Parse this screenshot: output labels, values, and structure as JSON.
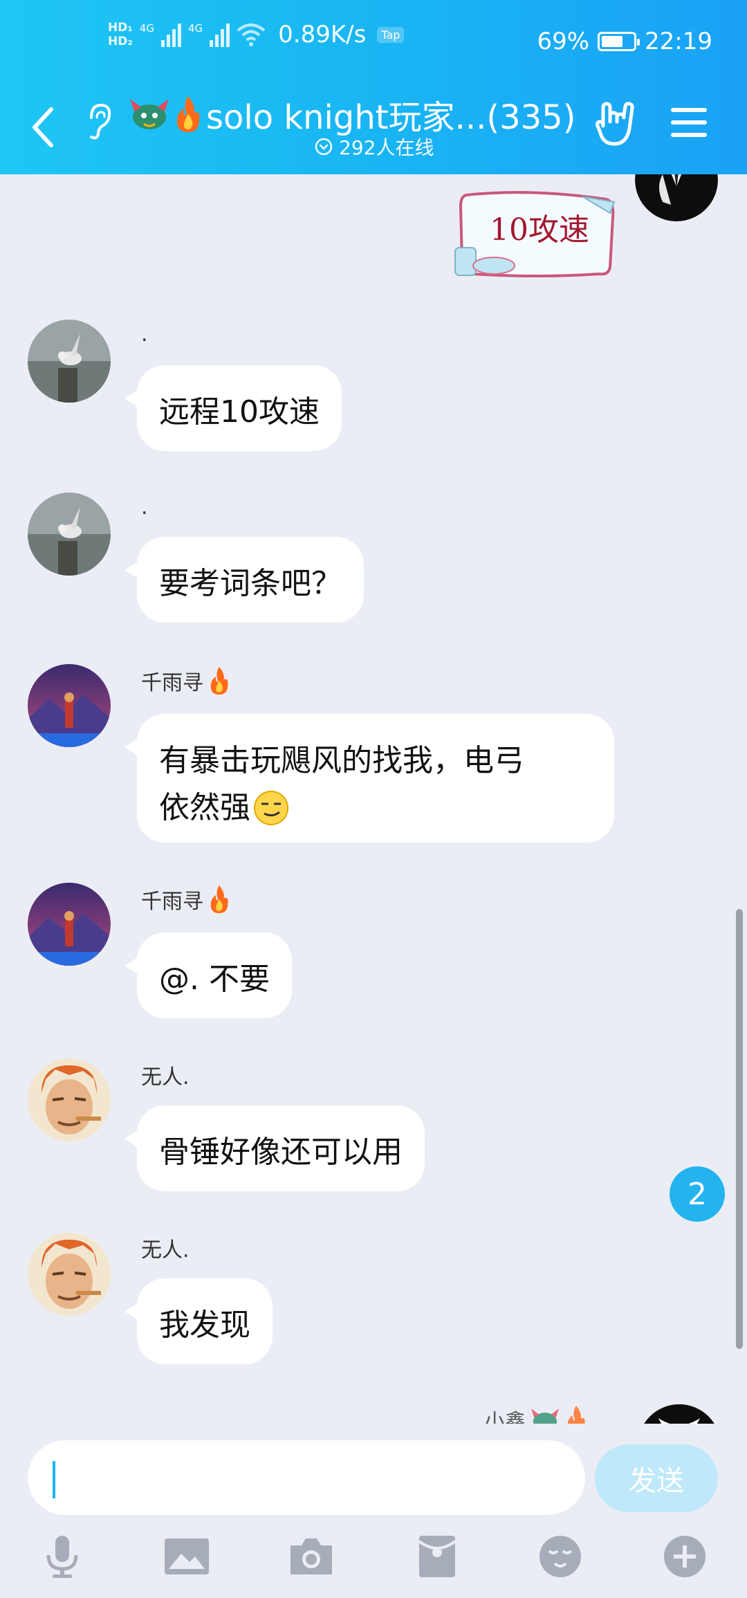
{
  "status_bar": {
    "hd1": "HD₁",
    "hd2": "HD₂",
    "net1": "4G",
    "net2": "4G",
    "speed": "0.89K/s",
    "tap_badge": "Tap",
    "battery_percent": "69%",
    "battery_level": 0.69,
    "time": "22:19"
  },
  "header": {
    "title": "solo knight玩家...(335)",
    "online": "292人在线"
  },
  "messages": [
    {
      "sender": ".",
      "text": "远程10攻速"
    },
    {
      "sender": ".",
      "text": "要考词条吧？"
    },
    {
      "sender": "千雨寻",
      "text_line1": "有暴击玩飓风的找我，电弓",
      "text_line2": "依然强"
    },
    {
      "sender": "千雨寻",
      "text": "@. 不要"
    },
    {
      "sender": "无人.",
      "text": "骨锤好像还可以用"
    },
    {
      "sender": "无人.",
      "text": "我发现"
    }
  ],
  "self_sticker_text": "10攻速",
  "partial_sender": "小鑫",
  "unread_count": "2",
  "input": {
    "value": "",
    "send_label": "发送"
  },
  "colors": {
    "header": "#1fb7f4",
    "send_disabled": "#bfe9fb",
    "badge": "#23b3ef",
    "background": "#ebedf5"
  },
  "toolbar_icons": [
    "mic-icon",
    "image-icon",
    "camera-icon",
    "red-packet-icon",
    "emoji-icon",
    "plus-icon"
  ]
}
